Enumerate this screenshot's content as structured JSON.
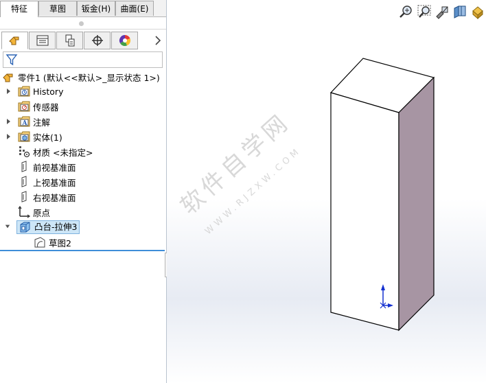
{
  "command_manager": {
    "tabs": [
      {
        "label": "特征",
        "active": true
      },
      {
        "label": "草图",
        "active": false
      },
      {
        "label": "钣金(H)",
        "active": false
      },
      {
        "label": "曲面(E)",
        "active": false
      }
    ]
  },
  "manager_tabs": [
    {
      "icon": "feature-manager-icon",
      "active": true
    },
    {
      "icon": "property-manager-icon",
      "active": false
    },
    {
      "icon": "configuration-manager-icon",
      "active": false
    },
    {
      "icon": "dimxpert-manager-icon",
      "active": false
    },
    {
      "icon": "display-manager-icon",
      "active": false
    }
  ],
  "feature_tree": {
    "root_label": "零件1  (默认<<默认>_显示状态 1>)",
    "items": [
      {
        "label": "History",
        "icon": "history-icon",
        "expandable": true
      },
      {
        "label": "传感器",
        "icon": "sensor-icon",
        "expandable": false
      },
      {
        "label": "注解",
        "icon": "annotation-icon",
        "expandable": true
      },
      {
        "label": "实体(1)",
        "icon": "solid-body-icon",
        "expandable": true
      },
      {
        "label": "材质 <未指定>",
        "icon": "material-icon",
        "expandable": false
      },
      {
        "label": "前视基准面",
        "icon": "plane-icon",
        "expandable": false
      },
      {
        "label": "上视基准面",
        "icon": "plane-icon",
        "expandable": false
      },
      {
        "label": "右视基准面",
        "icon": "plane-icon",
        "expandable": false
      },
      {
        "label": "原点",
        "icon": "origin-icon",
        "expandable": false
      },
      {
        "label": "凸台-拉伸3",
        "icon": "boss-extrude-icon",
        "expandable": true,
        "expanded": true,
        "selected": true
      },
      {
        "label": "草图2",
        "icon": "sketch-icon",
        "expandable": false,
        "child": true
      }
    ]
  },
  "heads_up_toolbar": [
    "zoom-to-fit-icon",
    "zoom-to-area-icon",
    "previous-view-icon",
    "section-view-icon",
    "view-orientation-icon"
  ],
  "watermark": {
    "main": "软件自学网",
    "sub": "WWW.RJZXW.COM"
  },
  "colors": {
    "selection": "#cde6f7",
    "accent_line": "#3e8ed8",
    "box_side": "#a795a3"
  }
}
